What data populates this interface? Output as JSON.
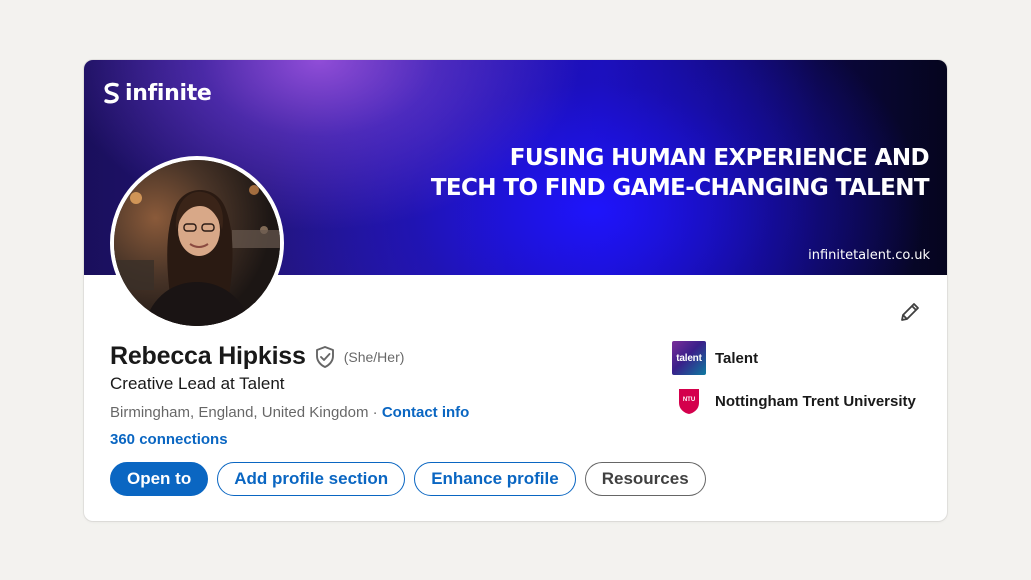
{
  "banner": {
    "logo_text": "infinite",
    "headline_line1": "FUSING HUMAN EXPERIENCE AND",
    "headline_line2": "TECH TO FIND GAME-CHANGING TALENT",
    "url": "infinitetalent.co.uk"
  },
  "profile": {
    "name": "Rebecca Hipkiss",
    "pronouns": "(She/Her)",
    "headline": "Creative Lead at Talent",
    "location": "Birmingham, England, United Kingdom",
    "separator": " · ",
    "contact_info": "Contact info",
    "connections": "360 connections"
  },
  "actions": {
    "open_to": "Open to",
    "add_section": "Add profile section",
    "enhance": "Enhance profile",
    "resources": "Resources"
  },
  "orgs": [
    {
      "name": "Talent",
      "logo_text": "talent"
    },
    {
      "name": "Nottingham Trent University",
      "logo_text": "NTU"
    }
  ],
  "colors": {
    "accent": "#0a66c2",
    "page_background": "#f3f2ef",
    "ntu_red": "#d4004c"
  },
  "icons": {
    "edit": "pencil-icon",
    "verified": "shield-check-icon"
  }
}
